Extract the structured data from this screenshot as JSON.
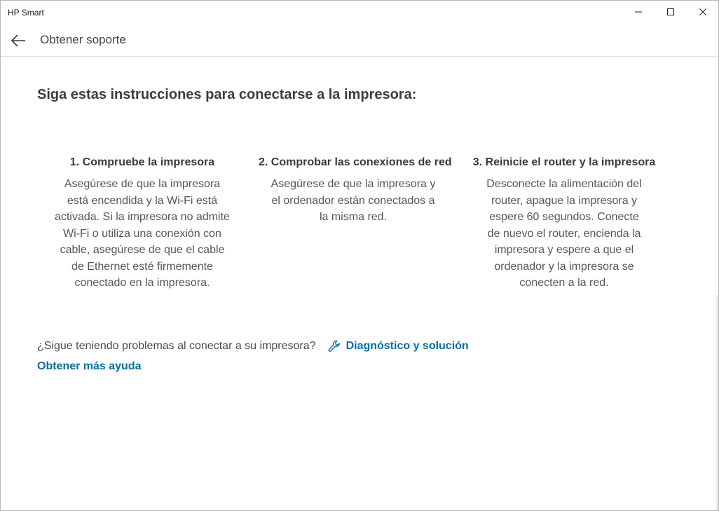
{
  "window": {
    "title": "HP Smart"
  },
  "header": {
    "title": "Obtener soporte"
  },
  "main": {
    "heading": "Siga estas instrucciones para conectarse a la impresora:",
    "steps": [
      {
        "title": "1. Compruebe la impresora",
        "description": "Asegúrese de que la impresora está encendida y la Wi-Fi está activada. Si la impresora no admite Wi-Fi o utiliza una conexión con cable, asegúrese de que el cable de Ethernet esté firmemente conectado en la impresora."
      },
      {
        "title": "2. Comprobar las conexiones de red",
        "description": "Asegúrese de que la impresora y el ordenador están conectados a la misma red."
      },
      {
        "title": "3. Reinicie el router y la impresora",
        "description": "Desconecte la alimentación del router, apague la impresora y espere 60 segundos. Conecte de nuevo el router, encienda la impresora y espere a que el ordenador y la impresora se conecten a la red."
      }
    ],
    "trouble_question": "¿Sigue teniendo problemas al conectar a su impresora?",
    "diagnose_label": "Diagnóstico y solución",
    "more_help_label": "Obtener más ayuda"
  },
  "colors": {
    "link": "#0a6d9c",
    "heading": "#3c3c3c",
    "body_text": "#555555"
  },
  "icons": {
    "back": "arrow-left-icon",
    "minimize": "minimize-icon",
    "maximize": "maximize-icon",
    "close": "close-icon",
    "diagnose": "wrench-icon"
  }
}
